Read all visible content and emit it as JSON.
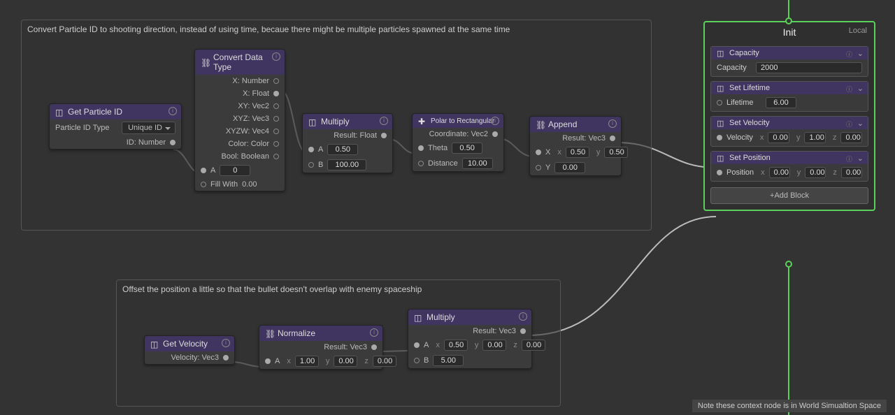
{
  "groups": {
    "g1_title": "Convert Particle ID to shooting direction, instead of using time, becaue there might be multiple particles spawned at the same time",
    "g2_title": "Offset the position a little so that the bullet doesn't overlap with enemy spaceship"
  },
  "note_text": "Note these context node is in World Simualtion Space",
  "nodes": {
    "get_particle_id": {
      "title": "Get Particle ID",
      "type_label": "Particle ID Type",
      "type_value": "Unique ID",
      "out_label": "ID: Number"
    },
    "convert": {
      "title": "Convert Data Type",
      "outputs": [
        "X: Number",
        "X: Float",
        "XY: Vec2",
        "XYZ: Vec3",
        "XYZW: Vec4",
        "Color: Color",
        "Bool: Boolean"
      ],
      "a_label": "A",
      "a_value": "0",
      "fill_label": "Fill With",
      "fill_value": "0.00"
    },
    "multiply1": {
      "title": "Multiply",
      "result": "Result: Float",
      "a_label": "A",
      "a_value": "0.50",
      "b_label": "B",
      "b_value": "100.00"
    },
    "polar": {
      "title": "Polar to Rectangular",
      "result": "Coordinate: Vec2",
      "theta_label": "Theta",
      "theta_value": "0.50",
      "dist_label": "Distance",
      "dist_value": "10.00"
    },
    "append": {
      "title": "Append",
      "result": "Result: Vec3",
      "x_label": "X",
      "xx": "0.50",
      "xy": "0.50",
      "y_label": "Y",
      "y_value": "0.00"
    },
    "get_velocity": {
      "title": "Get Velocity",
      "out_label": "Velocity: Vec3"
    },
    "normalize": {
      "title": "Normalize",
      "result": "Result: Vec3",
      "a_label": "A",
      "ax": "1.00",
      "ay": "0.00",
      "az": "0.00"
    },
    "multiply2": {
      "title": "Multiply",
      "result": "Result: Vec3",
      "a_label": "A",
      "ax": "0.50",
      "ay": "0.00",
      "az": "0.00",
      "b_label": "B",
      "b_value": "5.00"
    }
  },
  "context": {
    "title": "Init",
    "local": "Local",
    "add_block": "+Add Block",
    "blocks": {
      "capacity": {
        "title": "Capacity",
        "label": "Capacity",
        "value": "2000"
      },
      "lifetime": {
        "title": "Set Lifetime",
        "label": "Lifetime",
        "value": "6.00"
      },
      "velocity": {
        "title": "Set Velocity",
        "label": "Velocity",
        "x": "0.00",
        "y": "1.00",
        "z": "0.00"
      },
      "position": {
        "title": "Set Position",
        "label": "Position",
        "x": "0.00",
        "y": "0.00",
        "z": "0.00"
      }
    }
  }
}
